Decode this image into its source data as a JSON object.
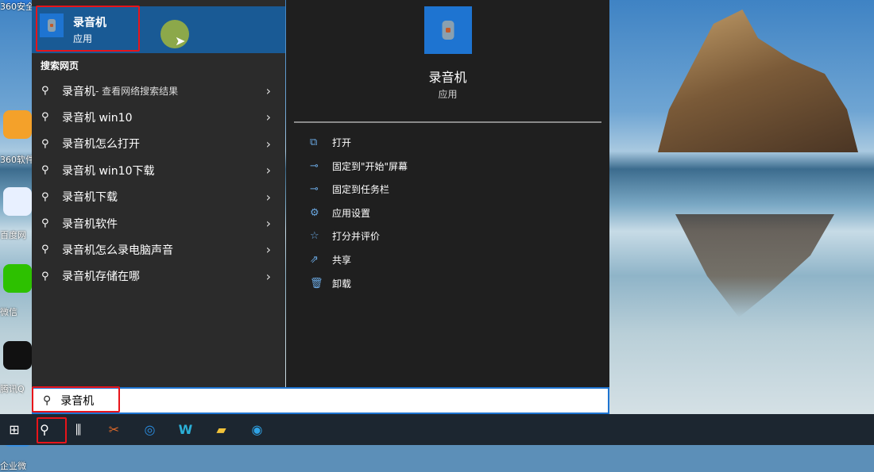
{
  "desktop": {
    "icons": [
      {
        "label": "360安全",
        "color": "#2e7bd6"
      },
      {
        "label": "360软件",
        "color": "#f4a12a"
      },
      {
        "label": "百度网",
        "color": "#e8f0ff"
      },
      {
        "label": "微信",
        "color": "#2dc100"
      },
      {
        "label": "腾讯Q",
        "color": "#111111"
      },
      {
        "label": "企业微",
        "color": "#3a8fe0"
      }
    ]
  },
  "best_match": {
    "name": "录音机",
    "type": "应用"
  },
  "web_section": "搜索网页",
  "suggestions": [
    {
      "main": "录音机",
      "sub": " - 查看网络搜索结果"
    },
    {
      "main": "录音机 win10",
      "sub": ""
    },
    {
      "main": "录音机怎么打开",
      "sub": ""
    },
    {
      "main": "录音机 win10下载",
      "sub": ""
    },
    {
      "main": "录音机下载",
      "sub": ""
    },
    {
      "main": "录音机软件",
      "sub": ""
    },
    {
      "main": "录音机怎么录电脑声音",
      "sub": ""
    },
    {
      "main": "录音机存储在哪",
      "sub": ""
    }
  ],
  "detail": {
    "name": "录音机",
    "type": "应用",
    "actions": [
      {
        "label": "打开",
        "icon": "open-icon"
      },
      {
        "label": "固定到\"开始\"屏幕",
        "icon": "pin-icon"
      },
      {
        "label": "固定到任务栏",
        "icon": "pin-icon"
      },
      {
        "label": "应用设置",
        "icon": "gear-icon"
      },
      {
        "label": "打分并评价",
        "icon": "star-icon"
      },
      {
        "label": "共享",
        "icon": "share-icon"
      },
      {
        "label": "卸载",
        "icon": "trash-icon"
      }
    ]
  },
  "search": {
    "value": "录音机"
  },
  "colors": {
    "accent": "#1e74d1",
    "highlight": "#195a95",
    "annotation": "#e8141a"
  }
}
